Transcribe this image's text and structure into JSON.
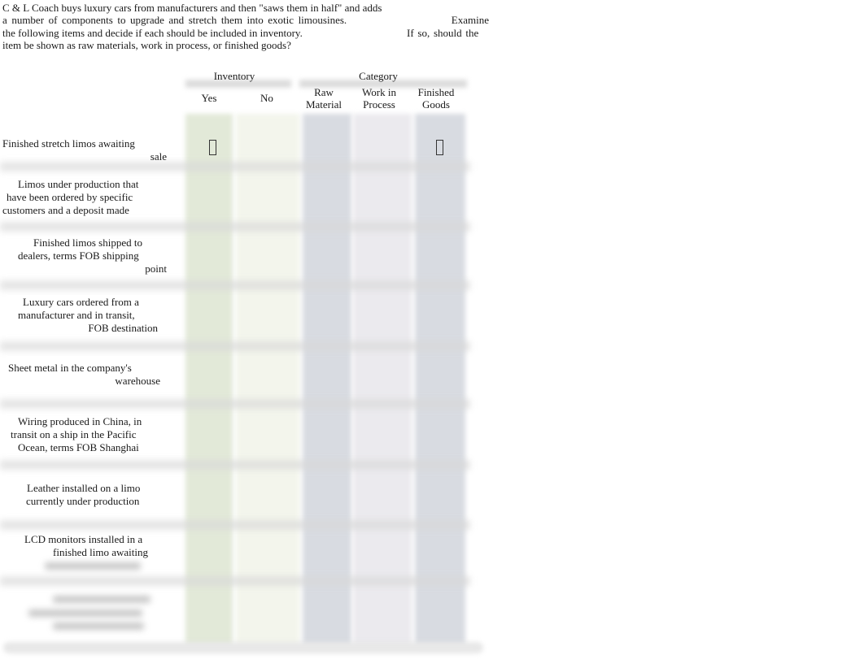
{
  "intro": {
    "line1": "C & L Coach buys luxury cars from manufacturers and then \"saws them in half\" and adds",
    "line2a": "a number of components to upgrade and stretch them into exotic limousines.",
    "line2b": "Examine",
    "line3a": "the following items and decide if each should be included in inventory.",
    "line3b": "If so, should the",
    "line4": "item be shown as raw materials, work in process, or finished goods?"
  },
  "table": {
    "group_headers": {
      "inventory": "Inventory",
      "category": "Category"
    },
    "columns": {
      "yes": "Yes",
      "no": "No",
      "raw_l1": "Raw",
      "raw_l2": "Material",
      "wip_l1": "Work in",
      "wip_l2": "Process",
      "fin_l1": "Finished",
      "fin_l2": "Goods"
    },
    "checkbox_glyph": "checkbox-empty",
    "rows": [
      {
        "lines": [
          "Finished stretch limos awaiting",
          "sale"
        ],
        "checkbox_columns": [
          "yes",
          "finished_goods"
        ]
      },
      {
        "lines": [
          "Limos under production that",
          "have been ordered by specific",
          "customers and a deposit made"
        ],
        "checkbox_columns": []
      },
      {
        "lines": [
          "Finished limos shipped to",
          "dealers, terms FOB shipping",
          "point"
        ],
        "checkbox_columns": []
      },
      {
        "lines": [
          "Luxury cars ordered from a",
          "manufacturer and in transit,",
          "FOB destination"
        ],
        "checkbox_columns": []
      },
      {
        "lines": [
          "Sheet metal in the company's",
          "warehouse"
        ],
        "checkbox_columns": []
      },
      {
        "lines": [
          "Wiring produced in China, in",
          "transit on a ship in the Pacific",
          "Ocean, terms FOB Shanghai"
        ],
        "checkbox_columns": []
      },
      {
        "lines": [
          "Leather installed on a limo",
          "currently under production"
        ],
        "checkbox_columns": []
      },
      {
        "lines": [
          "LCD monitors installed in a",
          "finished limo awaiting"
        ],
        "checkbox_columns": [],
        "obscured_continuation": true
      },
      {
        "lines": [],
        "checkbox_columns": [],
        "obscured": true
      }
    ]
  },
  "colors": {
    "yes_column": "#e2e9d8",
    "no_column": "#f3f5ec",
    "raw_column": "#d8dbe1",
    "wip_column": "#ebeaee",
    "finished_column": "#d8dbe1",
    "separator": "#d8d8d8"
  }
}
